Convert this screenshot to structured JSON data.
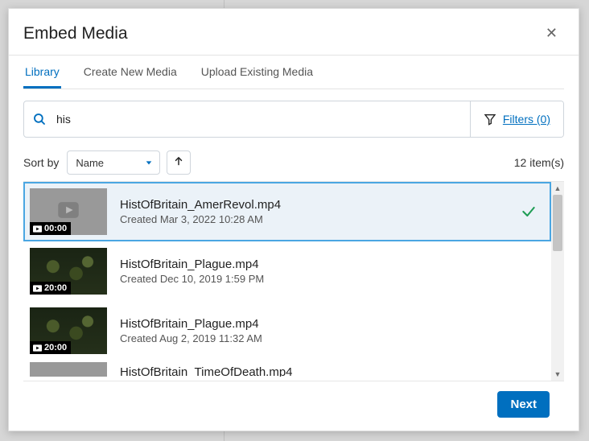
{
  "modal": {
    "title": "Embed Media",
    "close_label": "Close"
  },
  "tabs": {
    "library": "Library",
    "create": "Create New Media",
    "upload": "Upload Existing Media"
  },
  "search": {
    "value": "his",
    "filters_label": "Filters (0)"
  },
  "sort": {
    "label": "Sort by",
    "value": "Name"
  },
  "item_count": "12 item(s)",
  "items": [
    {
      "title": "HistOfBritain_AmerRevol.mp4",
      "created": "Created Mar 3, 2022 10:28 AM",
      "duration": "00:00",
      "selected": true,
      "thumb": "grey"
    },
    {
      "title": "HistOfBritain_Plague.mp4",
      "created": "Created Dec 10, 2019 1:59 PM",
      "duration": "20:00",
      "selected": false,
      "thumb": "dark"
    },
    {
      "title": "HistOfBritain_Plague.mp4",
      "created": "Created Aug 2, 2019 11:32 AM",
      "duration": "20:00",
      "selected": false,
      "thumb": "dark"
    },
    {
      "title": "HistOfBritain_TimeOfDeath.mp4",
      "created": "",
      "duration": "",
      "selected": false,
      "thumb": "grey",
      "partial": true
    }
  ],
  "footer": {
    "next": "Next"
  }
}
